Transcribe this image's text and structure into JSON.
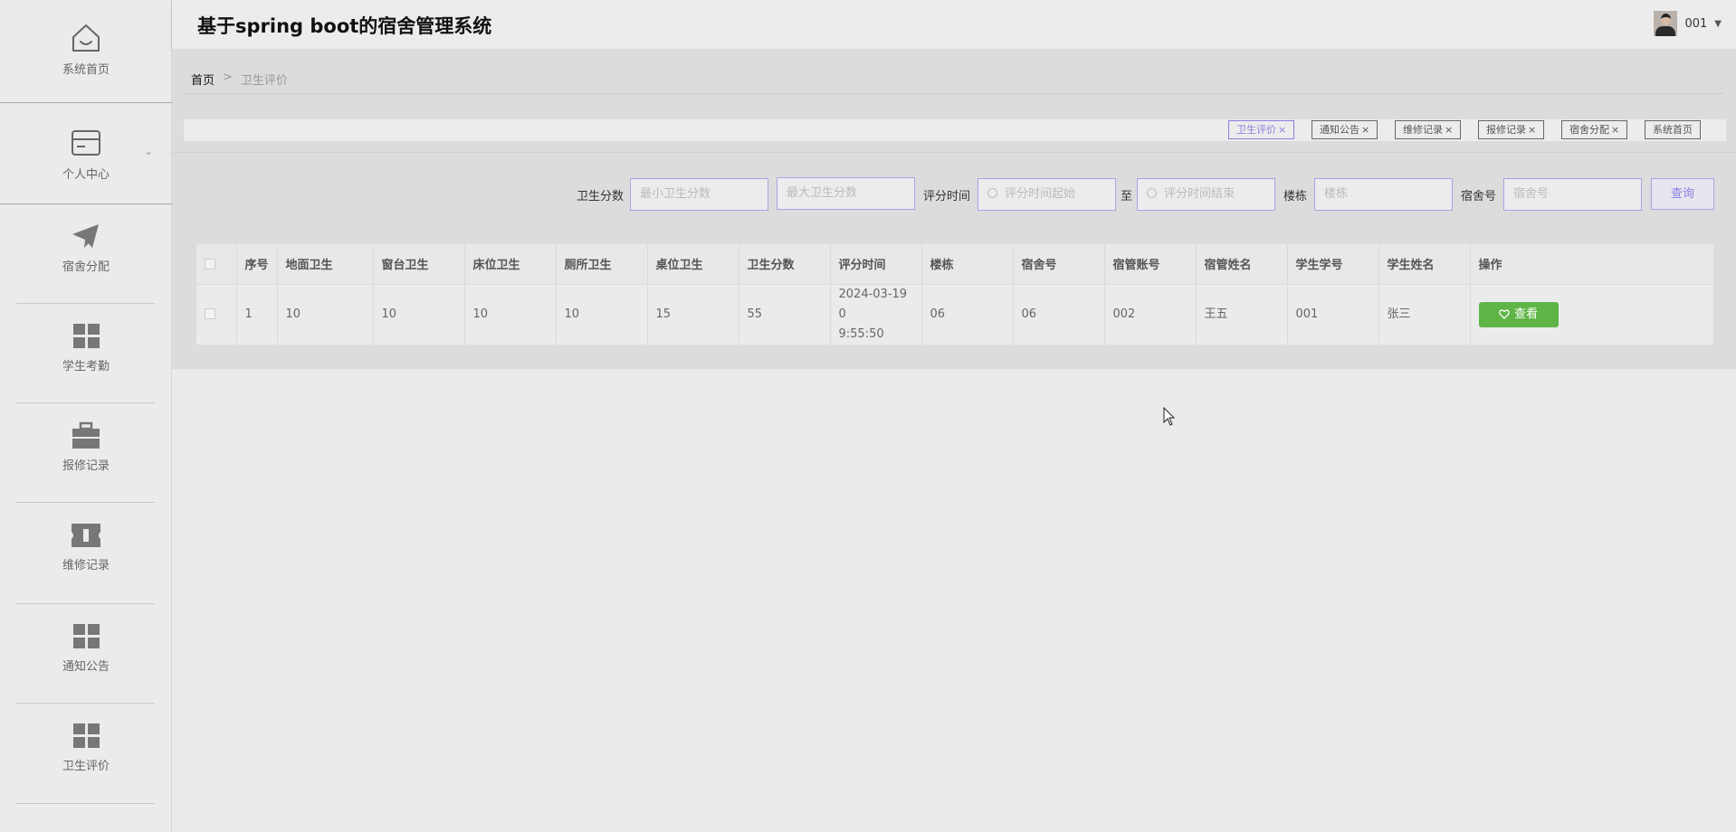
{
  "app": {
    "title": "基于spring boot的宿舍管理系统"
  },
  "user": {
    "name": "001"
  },
  "sidebar": {
    "items": [
      {
        "label": "系统首页",
        "icon": "home-icon"
      },
      {
        "label": "个人中心",
        "icon": "wallet-icon"
      },
      {
        "label": "宿舍分配",
        "icon": "paper-plane-icon"
      },
      {
        "label": "学生考勤",
        "icon": "grid-icon"
      },
      {
        "label": "报修记录",
        "icon": "briefcase-icon"
      },
      {
        "label": "维修记录",
        "icon": "ticket-icon"
      },
      {
        "label": "通知公告",
        "icon": "grid-icon"
      },
      {
        "label": "卫生评价",
        "icon": "grid-icon"
      }
    ]
  },
  "breadcrumb": {
    "home": "首页",
    "separator": ">",
    "current": "卫生评价"
  },
  "tags": [
    {
      "label": "卫生评价",
      "close": "×",
      "active": true
    },
    {
      "label": "通知公告",
      "close": "×"
    },
    {
      "label": "维修记录",
      "close": "×"
    },
    {
      "label": "报修记录",
      "close": "×"
    },
    {
      "label": "宿舍分配",
      "close": "×"
    },
    {
      "label": "系统首页",
      "close": ""
    }
  ],
  "search": {
    "score_label": "卫生分数",
    "min_score_placeholder": "最小卫生分数",
    "max_score_placeholder": "最大卫生分数",
    "time_label": "评分时间",
    "time_start_placeholder": "评分时间起始",
    "range_sep": "至",
    "time_end_placeholder": "评分时间结束",
    "building_label": "楼栋",
    "building_placeholder": "楼栋",
    "room_label": "宿舍号",
    "room_placeholder": "宿舍号",
    "query_button": "查询"
  },
  "table": {
    "columns": [
      "序号",
      "地面卫生",
      "窗台卫生",
      "床位卫生",
      "厕所卫生",
      "桌位卫生",
      "卫生分数",
      "评分时间",
      "楼栋",
      "宿舍号",
      "宿管账号",
      "宿管姓名",
      "学生学号",
      "学生姓名",
      "操作"
    ],
    "rows": [
      {
        "index": "1",
        "floor": "10",
        "window": "10",
        "bed": "10",
        "toilet": "10",
        "desk": "15",
        "score": "55",
        "time_line1": "2024-03-19 0",
        "time_line2": "9:55:50",
        "building": "06",
        "room": "06",
        "manager_account": "002",
        "manager_name": "王五",
        "student_id": "001",
        "student_name": "张三",
        "action": "查看"
      }
    ]
  },
  "colors": {
    "accent": "#8b7fe0",
    "view_button": "#5eb546"
  }
}
